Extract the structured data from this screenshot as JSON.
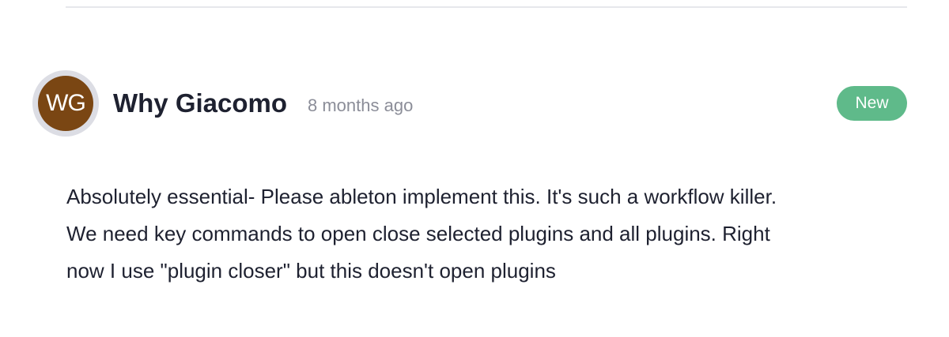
{
  "comment": {
    "avatar_initials": "WG",
    "author": "Why Giacomo",
    "timestamp": "8 months ago",
    "status": "New",
    "body_lines": [
      "Absolutely essential- Please ableton implement this. It's such a workflow killer.",
      "We need key commands to open close selected plugins and all plugins. Right",
      "now I use \"plugin closer\" but this doesn't open plugins"
    ]
  },
  "colors": {
    "avatar_bg": "#7a4613",
    "avatar_ring": "#dcdde4",
    "status_badge": "#5fba8a",
    "text_primary": "#1e2130",
    "text_muted": "#8b8d98",
    "divider": "#e6e7ec"
  }
}
